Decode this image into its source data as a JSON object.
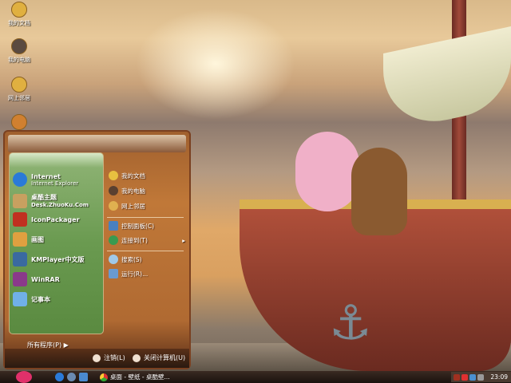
{
  "desktop": {
    "icons": [
      {
        "label": "我的文档"
      },
      {
        "label": "我的电脑"
      },
      {
        "label": "网上邻居"
      },
      {
        "label": ""
      }
    ]
  },
  "start_menu": {
    "pinned": [
      {
        "title": "Internet",
        "subtitle": "Internet Explorer",
        "icon": "ie-icon",
        "color": "#2a7ad8"
      },
      {
        "title": "桌酷主题",
        "subtitle": "Desk.ZhuoKu.Com",
        "icon": "zhuoku-icon",
        "color": "#c8a060"
      },
      {
        "title": "IconPackager",
        "subtitle": "",
        "icon": "iconpackager-icon",
        "color": "#c03020"
      },
      {
        "title": "画图",
        "subtitle": "",
        "icon": "paint-icon",
        "color": "#e0a040"
      },
      {
        "title": "KMPlayer中文版",
        "subtitle": "",
        "icon": "kmplayer-icon",
        "color": "#3a6aa0"
      },
      {
        "title": "WinRAR",
        "subtitle": "",
        "icon": "winrar-icon",
        "color": "#8a3a8a"
      },
      {
        "title": "记事本",
        "subtitle": "",
        "icon": "notepad-icon",
        "color": "#70b0e8"
      }
    ],
    "places": [
      {
        "label": "我的文档",
        "icon": "my-documents-icon",
        "color": "#e8c040"
      },
      {
        "label": "我的电脑",
        "icon": "my-computer-icon",
        "color": "#5a4030"
      },
      {
        "label": "网上邻居",
        "icon": "network-icon",
        "color": "#e0b050"
      },
      {
        "label": "控制面板(C)",
        "icon": "control-panel-icon",
        "color": "#4a80c0"
      },
      {
        "label": "连接到(T)",
        "icon": "connect-icon",
        "color": "#3a9a50"
      },
      {
        "label": "搜索(S)",
        "icon": "search-icon",
        "color": "#a0c8e8"
      },
      {
        "label": "运行(R)...",
        "icon": "run-icon",
        "color": "#6a9ad0"
      }
    ],
    "all_programs": "所有程序(P)",
    "log_off": "注销(L)",
    "shut_down": "关闭计算机(U)"
  },
  "taskbar": {
    "task_label": "桌面 - 壁纸 - 桌酷壁...",
    "clock": "23:09"
  }
}
